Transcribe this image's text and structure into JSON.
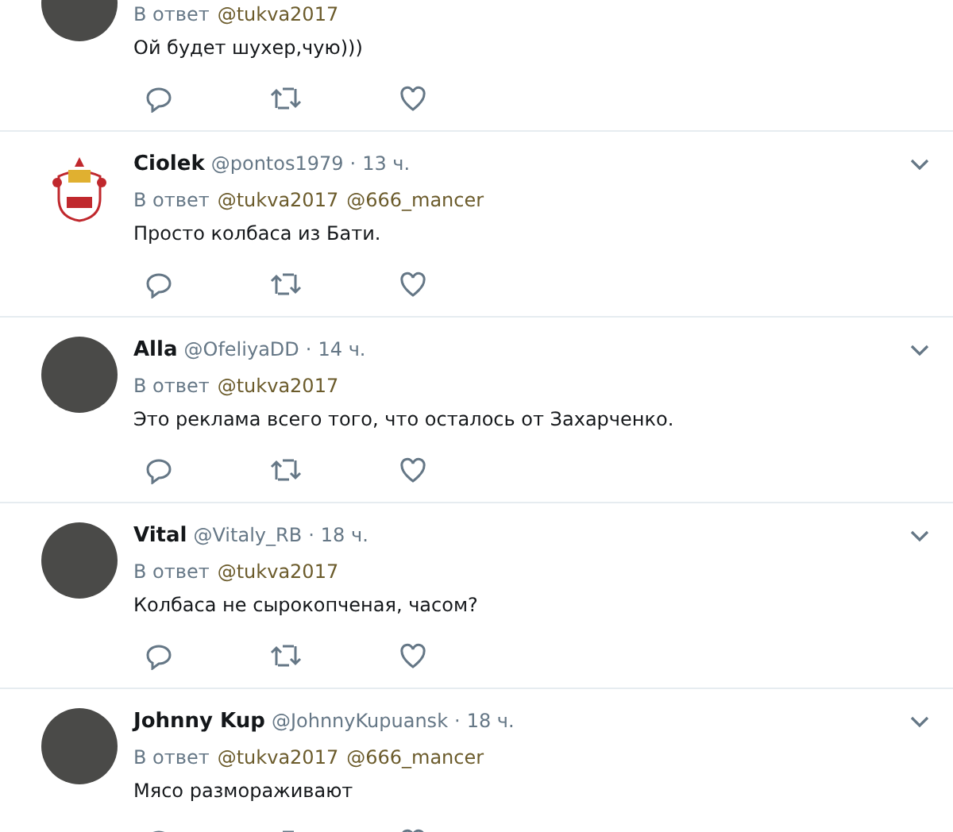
{
  "tweets": [
    {
      "kind": "partial",
      "reply_label": "В ответ",
      "mentions": [
        "@tukva2017"
      ],
      "text": "Ой будет шухер,чую)))",
      "avatar": {
        "kind": "photo"
      }
    },
    {
      "kind": "full",
      "name": "Ciolek",
      "handle": "@pontos1979",
      "separator": "·",
      "time": "13 ч.",
      "reply_label": "В ответ",
      "mentions": [
        "@tukva2017",
        "@666_mancer"
      ],
      "text": "Просто колбаса из Бати.",
      "avatar": {
        "kind": "crest"
      }
    },
    {
      "kind": "full",
      "name": "Alla",
      "handle": "@OfeliyaDD",
      "separator": "·",
      "time": "14 ч.",
      "reply_label": "В ответ",
      "mentions": [
        "@tukva2017"
      ],
      "text": "Это реклама всего того, что осталось от Захарченко.",
      "avatar": {
        "kind": "photo"
      }
    },
    {
      "kind": "full",
      "name": "Vital",
      "handle": "@Vitaly_RB",
      "separator": "·",
      "time": "18 ч.",
      "reply_label": "В ответ",
      "mentions": [
        "@tukva2017"
      ],
      "text": "Колбаса не сырокопченая, часом?",
      "avatar": {
        "kind": "photo"
      }
    },
    {
      "kind": "full",
      "name": "Johnny Kup",
      "handle": "@JohnnyKupuansk",
      "separator": "·",
      "time": "18 ч.",
      "reply_label": "В ответ",
      "mentions": [
        "@tukva2017",
        "@666_mancer"
      ],
      "text": "Мясо размораживают",
      "avatar": {
        "kind": "photo"
      }
    }
  ]
}
